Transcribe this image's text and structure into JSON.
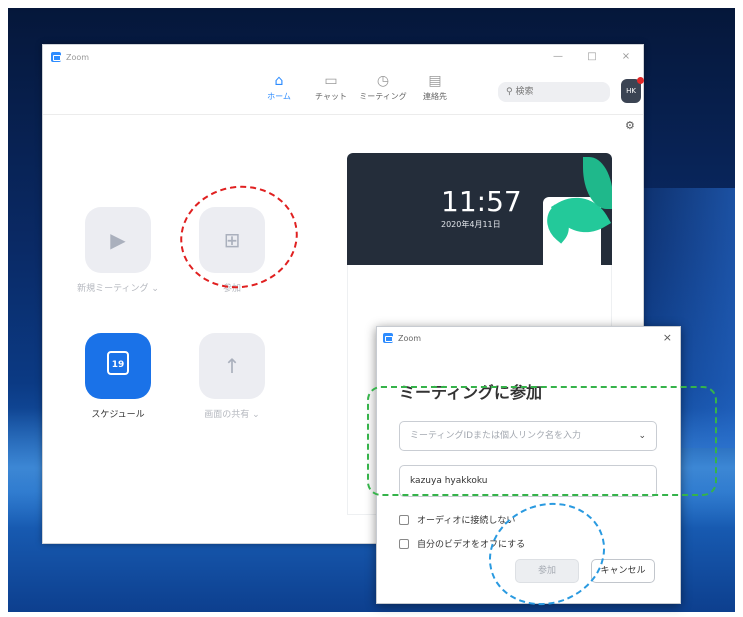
{
  "main_window": {
    "title": "Zoom",
    "controls": {
      "minimize": "—",
      "maximize": "□",
      "close": "×"
    },
    "nav": [
      {
        "label": "ホーム",
        "icon": "home-icon",
        "glyph": "⌂",
        "active": true
      },
      {
        "label": "チャット",
        "icon": "chat-icon",
        "glyph": "▭",
        "active": false
      },
      {
        "label": "ミーティング",
        "icon": "clock-icon",
        "glyph": "◷",
        "active": false
      },
      {
        "label": "連絡先",
        "icon": "contacts-icon",
        "glyph": "▤",
        "active": false
      }
    ],
    "search": {
      "icon": "search-icon",
      "glyph": "⚲",
      "text": "検索"
    },
    "avatar_initials": "HK",
    "settings_glyph": "⚙",
    "tiles": {
      "new_meeting": {
        "label": "新規ミーティング ⌄",
        "icon": "video-camera-icon",
        "glyph": "▶"
      },
      "join": {
        "label": "参加",
        "icon": "plus-icon",
        "glyph": "⊞"
      },
      "schedule": {
        "label": "スケジュール",
        "icon": "calendar-icon",
        "glyph": "19"
      },
      "share_screen": {
        "label": "画面の共有 ⌄",
        "icon": "upload-arrow-icon",
        "glyph": "↑"
      }
    },
    "clock": {
      "time": "11:57",
      "date": "2020年4月11日"
    }
  },
  "join_dialog": {
    "title": "Zoom",
    "close_glyph": "×",
    "heading": "ミーティングに参加",
    "meeting_id_placeholder": "ミーティングIDまたは個人リンク名を入力",
    "dropdown_glyph": "⌄",
    "name_value": "kazuya hyakkoku",
    "options": [
      {
        "label": "オーディオに接続しない",
        "checked": false
      },
      {
        "label": "自分のビデオをオフにする",
        "checked": false
      }
    ],
    "join_button": "参加",
    "cancel_button": "キャンセル"
  },
  "colors": {
    "zoom_blue": "#2d8cff",
    "schedule_blue": "#1a72e8",
    "annotation_red": "#e02020",
    "annotation_green": "#35b34a",
    "annotation_blue": "#2a9ae0"
  }
}
